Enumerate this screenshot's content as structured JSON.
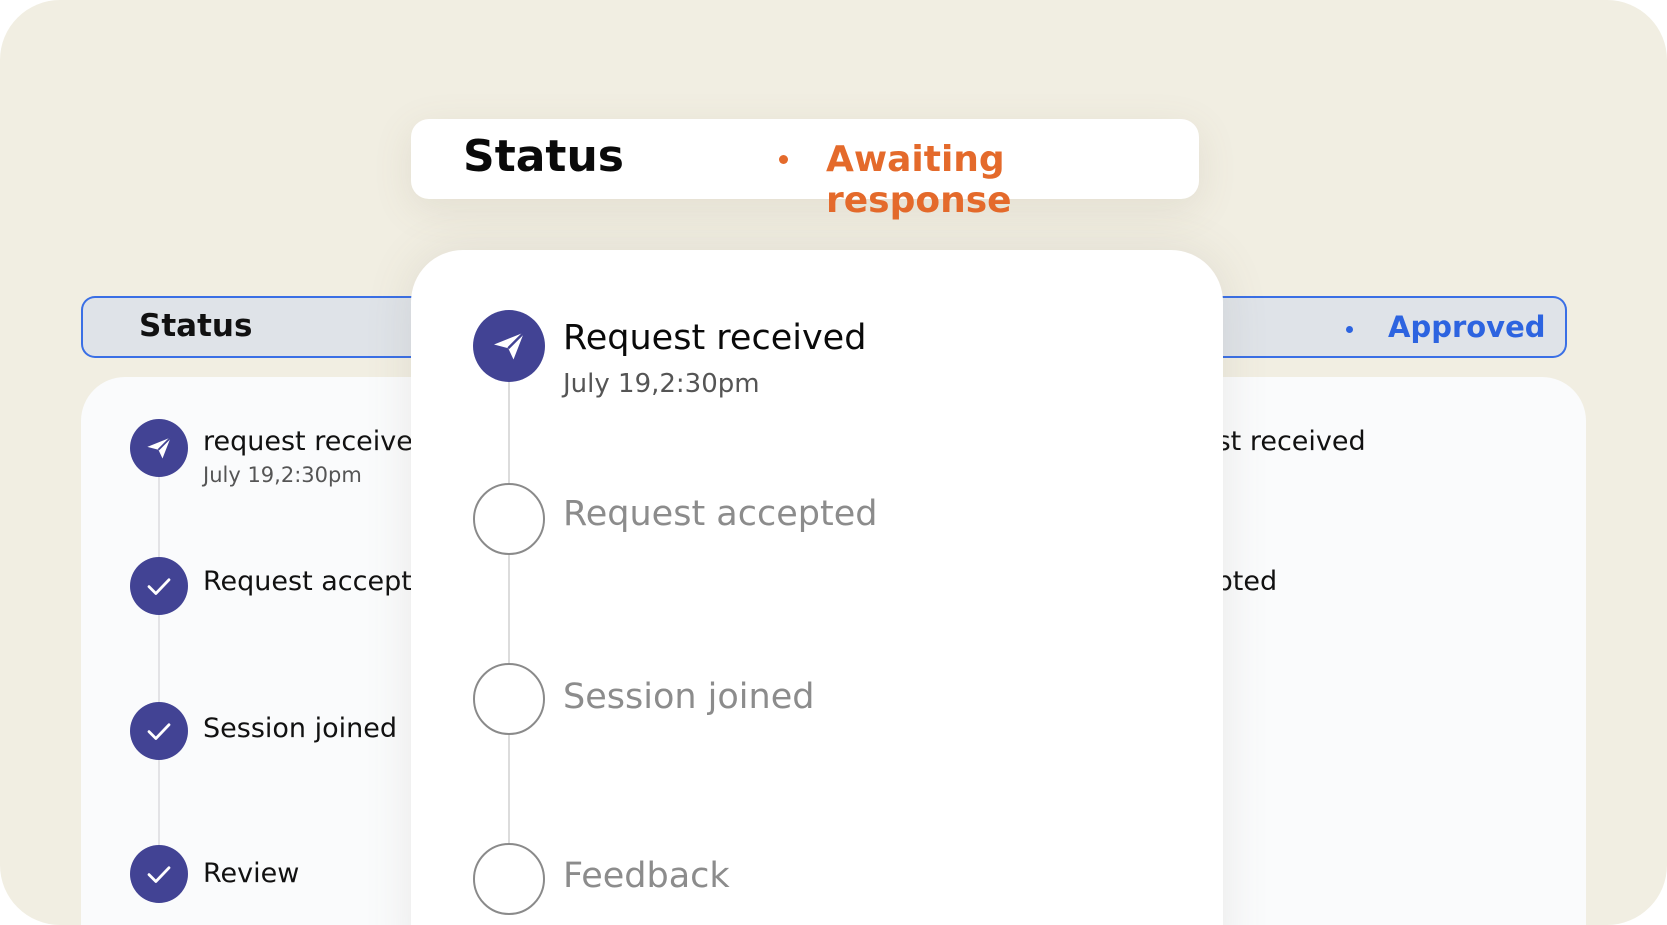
{
  "colors": {
    "background": "#f1eee2",
    "accent_indigo": "#424394",
    "awaiting_orange": "#e46a2b",
    "approved_blue": "#2d64e0"
  },
  "status_card": {
    "title": "Status",
    "status_text": "Awaiting response"
  },
  "timeline": [
    {
      "label": "Request received",
      "timestamp": "July 19,2:30pm",
      "state": "done",
      "icon": "paper-plane-icon"
    },
    {
      "label": "Request accepted",
      "state": "pending",
      "icon": "empty-circle-icon"
    },
    {
      "label": "Session joined",
      "state": "pending",
      "icon": "empty-circle-icon"
    },
    {
      "label": "Feedback",
      "state": "pending",
      "icon": "empty-circle-icon"
    }
  ],
  "background_left": {
    "title": "Status",
    "steps": [
      {
        "label": "request receive",
        "timestamp": "July 19,2:30pm",
        "icon": "paper-plane-icon"
      },
      {
        "label": "Request accept",
        "icon": "check-icon"
      },
      {
        "label": "Session joined",
        "icon": "check-icon"
      },
      {
        "label": "Review",
        "icon": "check-icon"
      }
    ]
  },
  "background_right": {
    "status_text": "Approved",
    "steps": [
      {
        "label": "est received"
      },
      {
        "label": "epted"
      }
    ]
  }
}
